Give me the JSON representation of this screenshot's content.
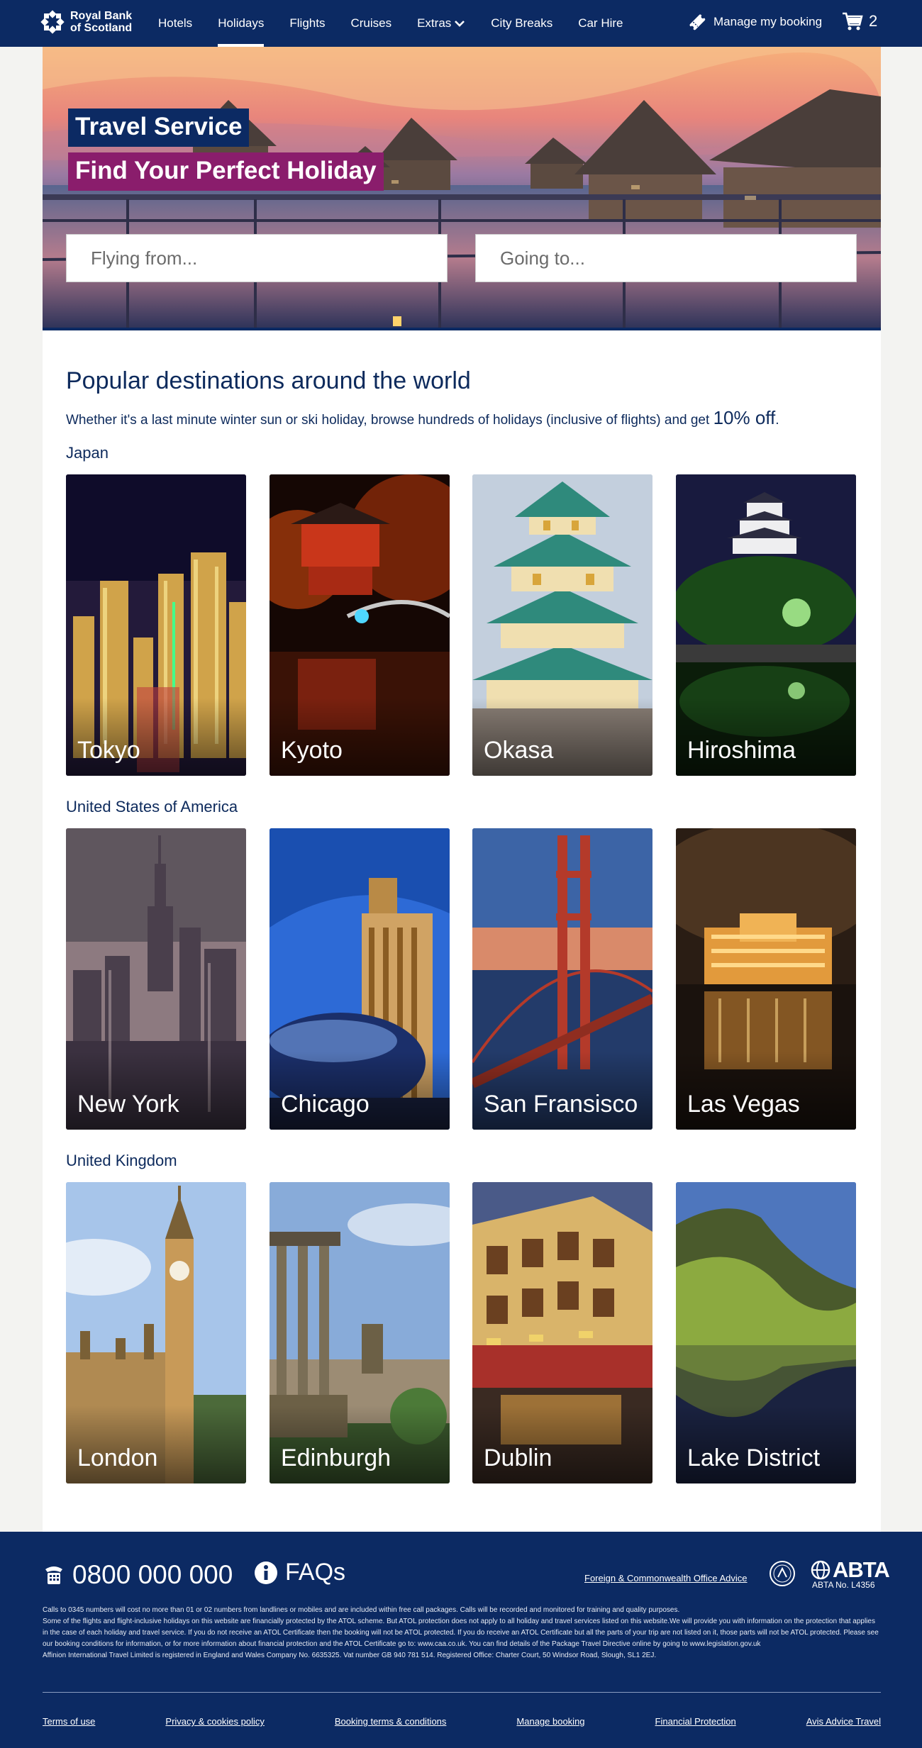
{
  "brand": {
    "name_line1": "Royal Bank",
    "name_line2": "of Scotland"
  },
  "nav": {
    "items": [
      {
        "label": "Hotels",
        "active": false
      },
      {
        "label": "Holidays",
        "active": true
      },
      {
        "label": "Flights",
        "active": false
      },
      {
        "label": "Cruises",
        "active": false
      },
      {
        "label": "Extras",
        "active": false,
        "dropdown": true
      },
      {
        "label": "City Breaks",
        "active": false
      },
      {
        "label": "Car Hire",
        "active": false
      }
    ],
    "manage_booking": "Manage my booking",
    "basket_count": "2"
  },
  "hero": {
    "badge_top": "Travel Service",
    "badge_bottom": "Find Your Perfect Holiday",
    "from_placeholder": "Flying from...",
    "to_placeholder": "Going to..."
  },
  "main": {
    "title": "Popular destinations around the world",
    "intro_text": "Whether it's a last minute winter sun or ski holiday, browse hundreds of holidays (inclusive of flights) and get ",
    "intro_highlight": "10% off",
    "intro_end": ".",
    "regions": [
      {
        "name": "Japan",
        "destinations": [
          "Tokyo",
          "Kyoto",
          "Okasa",
          "Hiroshima"
        ]
      },
      {
        "name": "United States of America",
        "destinations": [
          "New York",
          "Chicago",
          "San Fransisco",
          "Las Vegas"
        ]
      },
      {
        "name": "United Kingdom",
        "destinations": [
          "London",
          "Edinburgh",
          "Dublin",
          "Lake District"
        ]
      }
    ]
  },
  "footer": {
    "phone": "0800 000 000",
    "faqs": "FAQs",
    "fco_link": "Foreign & Commonwealth Office Advice",
    "abta_label": "ABTA",
    "abta_number": "ABTA No. L4356",
    "legal": [
      "Calls to 0345 numbers will cost no more than 01 or 02 numbers from landlines or mobiles and are included within free call packages. Calls will be recorded and monitored for training and quality purposes.",
      "Some of the flights and flight-inclusive holidays on this website are financially protected by the ATOL scheme. But ATOL protection does not apply to all holiday and travel services listed on this website.We will provide you with information on the protection that applies in the case of each holiday and travel service. If you do not receive an ATOL Certificate then the booking will not be ATOL protected. If you do receive an ATOL Certificate but all the parts of your trip are not listed on it, those parts will not be ATOL protected. Please see our booking conditions for information, or for more information about financial protection and the ATOL Certificate go to: www.caa.co.uk. You can find details of the Package Travel Directive online by going to www.legislation.gov.uk",
      "Affinion International Travel Limited is registered in England and Wales Company No. 6635325. Vat number GB 940 781 514. Registered Office: Charter Court, 50 Windsor Road, Slough, SL1 2EJ."
    ],
    "links": [
      "Terms of use",
      "Privacy & cookies policy",
      "Booking terms & conditions",
      "Manage booking",
      "Financial Protection",
      "Avis Advice Travel"
    ]
  },
  "colors": {
    "navy": "#0c2a63",
    "magenta": "#8a1d6c",
    "heading": "#0d2a5c"
  }
}
